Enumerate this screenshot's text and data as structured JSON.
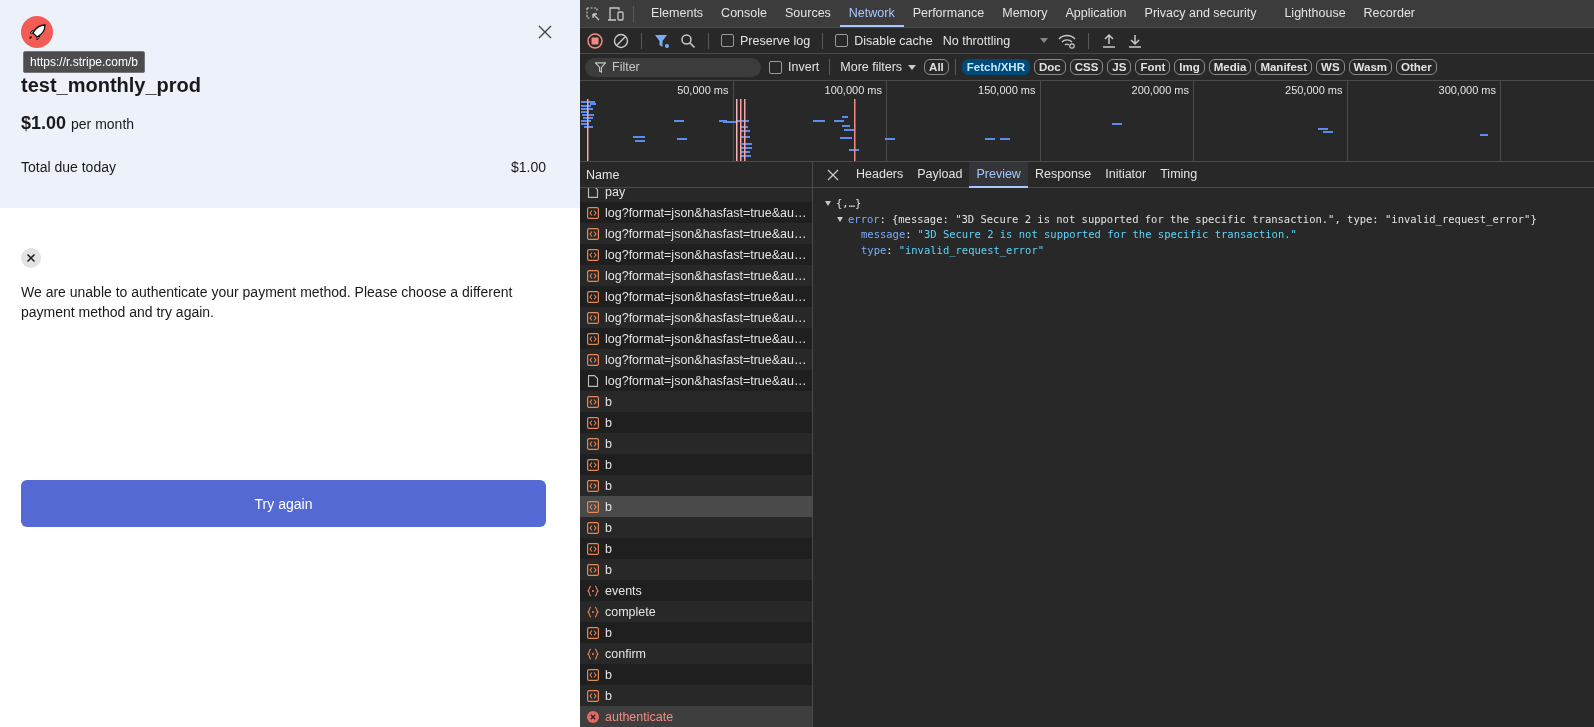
{
  "checkout": {
    "tooltip": "https://r.stripe.com/b",
    "product": "test_monthly_prod",
    "price": "$1.00",
    "interval": "per month",
    "total_label": "Total due today",
    "total_value": "$1.00",
    "error_message": "We are unable to authenticate your payment method. Please choose a different payment method and try again.",
    "button": "Try again"
  },
  "devtools": {
    "tabs": [
      {
        "label": "Elements",
        "selected": false
      },
      {
        "label": "Console",
        "selected": false
      },
      {
        "label": "Sources",
        "selected": false
      },
      {
        "label": "Network",
        "selected": true
      },
      {
        "label": "Performance",
        "selected": false
      },
      {
        "label": "Memory",
        "selected": false
      },
      {
        "label": "Application",
        "selected": false
      },
      {
        "label": "Privacy and security",
        "selected": false
      },
      {
        "label": "Lighthouse",
        "selected": false
      },
      {
        "label": "Recorder",
        "selected": false
      }
    ],
    "toolbar": {
      "preserve_log": {
        "label": "Preserve log",
        "checked": false
      },
      "disable_cache": {
        "label": "Disable cache",
        "checked": false
      },
      "throttling": "No throttling"
    },
    "filter": {
      "placeholder": "Filter",
      "invert": {
        "label": "Invert",
        "checked": false
      },
      "more_filters": "More filters",
      "types": [
        {
          "label": "All",
          "selected": false
        },
        {
          "label": "Fetch/XHR",
          "selected": true
        },
        {
          "label": "Doc",
          "selected": false
        },
        {
          "label": "CSS",
          "selected": false
        },
        {
          "label": "JS",
          "selected": false
        },
        {
          "label": "Font",
          "selected": false
        },
        {
          "label": "Img",
          "selected": false
        },
        {
          "label": "Media",
          "selected": false
        },
        {
          "label": "Manifest",
          "selected": false
        },
        {
          "label": "WS",
          "selected": false
        },
        {
          "label": "Wasm",
          "selected": false
        },
        {
          "label": "Other",
          "selected": false
        }
      ]
    },
    "timeline": {
      "ticks": [
        "50,000 ms",
        "100,000 ms",
        "150,000 ms",
        "200,000 ms",
        "250,000 ms",
        "300,000 ms"
      ]
    },
    "requests": {
      "column": "Name",
      "rows": [
        {
          "name": "pay",
          "kind": "document",
          "selected": false,
          "highlighted": false
        },
        {
          "name": "log?format=json&hasfast=true&au…",
          "kind": "xhr",
          "selected": false,
          "highlighted": false
        },
        {
          "name": "log?format=json&hasfast=true&au…",
          "kind": "xhr",
          "selected": false,
          "highlighted": false
        },
        {
          "name": "log?format=json&hasfast=true&au…",
          "kind": "xhr",
          "selected": false,
          "highlighted": false
        },
        {
          "name": "log?format=json&hasfast=true&au…",
          "kind": "xhr",
          "selected": false,
          "highlighted": false
        },
        {
          "name": "log?format=json&hasfast=true&au…",
          "kind": "xhr",
          "selected": false,
          "highlighted": false
        },
        {
          "name": "log?format=json&hasfast=true&au…",
          "kind": "xhr",
          "selected": false,
          "highlighted": false
        },
        {
          "name": "log?format=json&hasfast=true&au…",
          "kind": "xhr",
          "selected": false,
          "highlighted": false
        },
        {
          "name": "log?format=json&hasfast=true&au…",
          "kind": "xhr",
          "selected": false,
          "highlighted": false
        },
        {
          "name": "log?format=json&hasfast=true&au…",
          "kind": "document",
          "selected": false,
          "highlighted": false
        },
        {
          "name": "b",
          "kind": "xhr",
          "selected": false,
          "highlighted": false
        },
        {
          "name": "b",
          "kind": "xhr",
          "selected": false,
          "highlighted": false
        },
        {
          "name": "b",
          "kind": "xhr",
          "selected": false,
          "highlighted": false
        },
        {
          "name": "b",
          "kind": "xhr",
          "selected": false,
          "highlighted": false
        },
        {
          "name": "b",
          "kind": "xhr",
          "selected": false,
          "highlighted": false
        },
        {
          "name": "b",
          "kind": "xhr",
          "selected": false,
          "highlighted": true
        },
        {
          "name": "b",
          "kind": "xhr",
          "selected": false,
          "highlighted": false
        },
        {
          "name": "b",
          "kind": "xhr",
          "selected": false,
          "highlighted": false
        },
        {
          "name": "b",
          "kind": "xhr",
          "selected": false,
          "highlighted": false
        },
        {
          "name": "events",
          "kind": "fetch",
          "selected": false,
          "highlighted": false
        },
        {
          "name": "complete",
          "kind": "fetch",
          "selected": false,
          "highlighted": false
        },
        {
          "name": "b",
          "kind": "xhr",
          "selected": false,
          "highlighted": false
        },
        {
          "name": "confirm",
          "kind": "fetch",
          "selected": false,
          "highlighted": false
        },
        {
          "name": "b",
          "kind": "xhr",
          "selected": false,
          "highlighted": false
        },
        {
          "name": "b",
          "kind": "xhr",
          "selected": false,
          "highlighted": false
        },
        {
          "name": "authenticate",
          "kind": "error",
          "selected": true,
          "highlighted": false
        }
      ]
    },
    "detail": {
      "tabs": [
        {
          "label": "Headers",
          "selected": false
        },
        {
          "label": "Payload",
          "selected": false
        },
        {
          "label": "Preview",
          "selected": true
        },
        {
          "label": "Response",
          "selected": false
        },
        {
          "label": "Initiator",
          "selected": false
        },
        {
          "label": "Timing",
          "selected": false
        }
      ],
      "preview": {
        "summary": "{,…}",
        "expanded": true,
        "children": [
          {
            "key": "error",
            "sep": ":",
            "summary": "{message: \"3D Secure 2 is not supported for the specific transaction.\", type: \"invalid_request_error\"}",
            "expanded": true,
            "children": [
              {
                "key": "message",
                "sep": ":",
                "value": "\"3D Secure 2 is not supported for the specific transaction.\""
              },
              {
                "key": "type",
                "sep": ":",
                "value": "\"invalid_request_error\""
              }
            ]
          }
        ]
      }
    }
  }
}
